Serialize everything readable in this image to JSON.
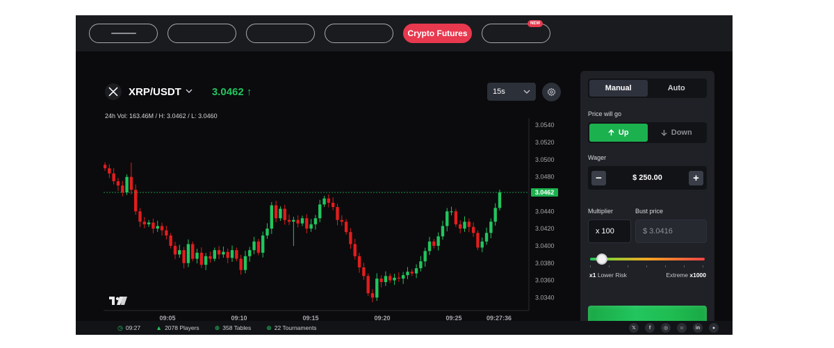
{
  "nav": {
    "items": [
      {
        "label": "",
        "active": false
      },
      {
        "label": "",
        "active": false
      },
      {
        "label": "",
        "active": false
      },
      {
        "label": "",
        "active": false
      },
      {
        "label": "Crypto Futures",
        "active": true
      },
      {
        "label": "",
        "active": false,
        "badge": "NEW"
      }
    ]
  },
  "header": {
    "pair": "XRP/USDT",
    "price": "3.0462 ↑",
    "stats": "24h Vol: 163.46M / H: 3.0462 / L: 3.0460",
    "interval": "15s"
  },
  "panel": {
    "modes": [
      "Manual",
      "Auto"
    ],
    "active_mode": "Manual",
    "price_will_go_label": "Price will go",
    "up_label": "Up",
    "down_label": "Down",
    "wager_label": "Wager",
    "wager_value": "$ 250.00",
    "minus_label": "−",
    "plus_label": "+",
    "multiplier_label": "Multiplier",
    "multiplier_value": "x 100",
    "bust_label": "Bust price",
    "bust_value": "$ 3.0416",
    "risk_min_value": "x1",
    "risk_min_label": "Lower Risk",
    "risk_max_label": "Extreme",
    "risk_max_value": "x1000",
    "slider_fraction": 0.1
  },
  "footer": {
    "time": "09:27",
    "players": "2078 Players",
    "tables": "358 Tables",
    "tournaments": "22 Tournaments",
    "socials": [
      "x-icon",
      "facebook-icon",
      "instagram-icon",
      "discord-icon",
      "linkedin-icon",
      "reddit-icon"
    ]
  },
  "colors": {
    "accent": "#e8394f",
    "up": "#22c55e",
    "down": "#e11d1d",
    "background": "#0b0b0d",
    "panel": "#1f2127"
  },
  "chart_data": {
    "type": "candlestick",
    "x_ticks": [
      "09:05",
      "09:10",
      "09:15",
      "09:20",
      "09:25",
      "09:27:36"
    ],
    "y_ticks": [
      3.054,
      3.052,
      3.05,
      3.048,
      3.044,
      3.042,
      3.04,
      3.038,
      3.036,
      3.034
    ],
    "ylim": [
      3.0325,
      3.0545
    ],
    "last_price": 3.0462,
    "last_price_label": "3.0462",
    "closes": [
      3.049,
      3.0484,
      3.0475,
      3.047,
      3.0462,
      3.048,
      3.0465,
      3.044,
      3.0428,
      3.0425,
      3.0427,
      3.042,
      3.0423,
      3.0418,
      3.0412,
      3.04,
      3.039,
      3.0395,
      3.038,
      3.0402,
      3.0385,
      3.0392,
      3.0378,
      3.0388,
      3.0385,
      3.0395,
      3.039,
      3.0393,
      3.0386,
      3.0395,
      3.0385,
      3.0372,
      3.0388,
      3.0395,
      3.0405,
      3.0392,
      3.0412,
      3.042,
      3.0447,
      3.0432,
      3.0443,
      3.043,
      3.0428,
      3.043,
      3.0426,
      3.0432,
      3.042,
      3.0425,
      3.0432,
      3.0448,
      3.0455,
      3.045,
      3.0445,
      3.043,
      3.0428,
      3.0416,
      3.0402,
      3.0388,
      3.0375,
      3.0365,
      3.0345,
      3.034,
      3.0362,
      3.0358,
      3.0365,
      3.036,
      3.0363,
      3.0362,
      3.0366,
      3.037,
      3.0368,
      3.0374,
      3.0382,
      3.0394,
      3.0405,
      3.04,
      3.0411,
      3.0423,
      3.044,
      3.044,
      3.0425,
      3.042,
      3.0428,
      3.0422,
      3.0415,
      3.0398,
      3.0405,
      3.0415,
      3.0428,
      3.0444,
      3.0462
    ]
  }
}
